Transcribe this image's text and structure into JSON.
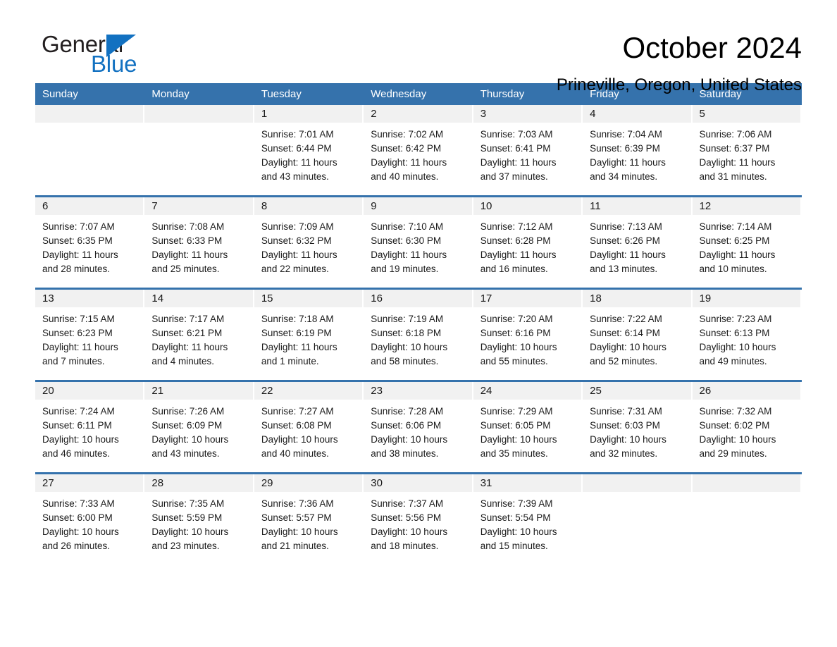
{
  "brand": {
    "name_part1": "General",
    "name_part2": "Blue",
    "accent_color": "#1271c1",
    "triangle_color": "#1271c1"
  },
  "header": {
    "title": "October 2024",
    "subtitle": "Prineville, Oregon, United States"
  },
  "theme": {
    "header_blue": "#3572ac",
    "cell_band_gray": "#f1f1f1",
    "text_color": "#1a1a1a",
    "separator_blue": "#3572ac"
  },
  "calendar": {
    "weekday_headers": [
      "Sunday",
      "Monday",
      "Tuesday",
      "Wednesday",
      "Thursday",
      "Friday",
      "Saturday"
    ],
    "weeks": [
      [
        {
          "day": "",
          "empty": true,
          "lines": []
        },
        {
          "day": "",
          "empty": true,
          "lines": []
        },
        {
          "day": "1",
          "lines": [
            "Sunrise: 7:01 AM",
            "Sunset: 6:44 PM",
            "Daylight: 11 hours",
            "and 43 minutes."
          ]
        },
        {
          "day": "2",
          "lines": [
            "Sunrise: 7:02 AM",
            "Sunset: 6:42 PM",
            "Daylight: 11 hours",
            "and 40 minutes."
          ]
        },
        {
          "day": "3",
          "lines": [
            "Sunrise: 7:03 AM",
            "Sunset: 6:41 PM",
            "Daylight: 11 hours",
            "and 37 minutes."
          ]
        },
        {
          "day": "4",
          "lines": [
            "Sunrise: 7:04 AM",
            "Sunset: 6:39 PM",
            "Daylight: 11 hours",
            "and 34 minutes."
          ]
        },
        {
          "day": "5",
          "lines": [
            "Sunrise: 7:06 AM",
            "Sunset: 6:37 PM",
            "Daylight: 11 hours",
            "and 31 minutes."
          ]
        }
      ],
      [
        {
          "day": "6",
          "lines": [
            "Sunrise: 7:07 AM",
            "Sunset: 6:35 PM",
            "Daylight: 11 hours",
            "and 28 minutes."
          ]
        },
        {
          "day": "7",
          "lines": [
            "Sunrise: 7:08 AM",
            "Sunset: 6:33 PM",
            "Daylight: 11 hours",
            "and 25 minutes."
          ]
        },
        {
          "day": "8",
          "lines": [
            "Sunrise: 7:09 AM",
            "Sunset: 6:32 PM",
            "Daylight: 11 hours",
            "and 22 minutes."
          ]
        },
        {
          "day": "9",
          "lines": [
            "Sunrise: 7:10 AM",
            "Sunset: 6:30 PM",
            "Daylight: 11 hours",
            "and 19 minutes."
          ]
        },
        {
          "day": "10",
          "lines": [
            "Sunrise: 7:12 AM",
            "Sunset: 6:28 PM",
            "Daylight: 11 hours",
            "and 16 minutes."
          ]
        },
        {
          "day": "11",
          "lines": [
            "Sunrise: 7:13 AM",
            "Sunset: 6:26 PM",
            "Daylight: 11 hours",
            "and 13 minutes."
          ]
        },
        {
          "day": "12",
          "lines": [
            "Sunrise: 7:14 AM",
            "Sunset: 6:25 PM",
            "Daylight: 11 hours",
            "and 10 minutes."
          ]
        }
      ],
      [
        {
          "day": "13",
          "lines": [
            "Sunrise: 7:15 AM",
            "Sunset: 6:23 PM",
            "Daylight: 11 hours",
            "and 7 minutes."
          ]
        },
        {
          "day": "14",
          "lines": [
            "Sunrise: 7:17 AM",
            "Sunset: 6:21 PM",
            "Daylight: 11 hours",
            "and 4 minutes."
          ]
        },
        {
          "day": "15",
          "lines": [
            "Sunrise: 7:18 AM",
            "Sunset: 6:19 PM",
            "Daylight: 11 hours",
            "and 1 minute."
          ]
        },
        {
          "day": "16",
          "lines": [
            "Sunrise: 7:19 AM",
            "Sunset: 6:18 PM",
            "Daylight: 10 hours",
            "and 58 minutes."
          ]
        },
        {
          "day": "17",
          "lines": [
            "Sunrise: 7:20 AM",
            "Sunset: 6:16 PM",
            "Daylight: 10 hours",
            "and 55 minutes."
          ]
        },
        {
          "day": "18",
          "lines": [
            "Sunrise: 7:22 AM",
            "Sunset: 6:14 PM",
            "Daylight: 10 hours",
            "and 52 minutes."
          ]
        },
        {
          "day": "19",
          "lines": [
            "Sunrise: 7:23 AM",
            "Sunset: 6:13 PM",
            "Daylight: 10 hours",
            "and 49 minutes."
          ]
        }
      ],
      [
        {
          "day": "20",
          "lines": [
            "Sunrise: 7:24 AM",
            "Sunset: 6:11 PM",
            "Daylight: 10 hours",
            "and 46 minutes."
          ]
        },
        {
          "day": "21",
          "lines": [
            "Sunrise: 7:26 AM",
            "Sunset: 6:09 PM",
            "Daylight: 10 hours",
            "and 43 minutes."
          ]
        },
        {
          "day": "22",
          "lines": [
            "Sunrise: 7:27 AM",
            "Sunset: 6:08 PM",
            "Daylight: 10 hours",
            "and 40 minutes."
          ]
        },
        {
          "day": "23",
          "lines": [
            "Sunrise: 7:28 AM",
            "Sunset: 6:06 PM",
            "Daylight: 10 hours",
            "and 38 minutes."
          ]
        },
        {
          "day": "24",
          "lines": [
            "Sunrise: 7:29 AM",
            "Sunset: 6:05 PM",
            "Daylight: 10 hours",
            "and 35 minutes."
          ]
        },
        {
          "day": "25",
          "lines": [
            "Sunrise: 7:31 AM",
            "Sunset: 6:03 PM",
            "Daylight: 10 hours",
            "and 32 minutes."
          ]
        },
        {
          "day": "26",
          "lines": [
            "Sunrise: 7:32 AM",
            "Sunset: 6:02 PM",
            "Daylight: 10 hours",
            "and 29 minutes."
          ]
        }
      ],
      [
        {
          "day": "27",
          "lines": [
            "Sunrise: 7:33 AM",
            "Sunset: 6:00 PM",
            "Daylight: 10 hours",
            "and 26 minutes."
          ]
        },
        {
          "day": "28",
          "lines": [
            "Sunrise: 7:35 AM",
            "Sunset: 5:59 PM",
            "Daylight: 10 hours",
            "and 23 minutes."
          ]
        },
        {
          "day": "29",
          "lines": [
            "Sunrise: 7:36 AM",
            "Sunset: 5:57 PM",
            "Daylight: 10 hours",
            "and 21 minutes."
          ]
        },
        {
          "day": "30",
          "lines": [
            "Sunrise: 7:37 AM",
            "Sunset: 5:56 PM",
            "Daylight: 10 hours",
            "and 18 minutes."
          ]
        },
        {
          "day": "31",
          "lines": [
            "Sunrise: 7:39 AM",
            "Sunset: 5:54 PM",
            "Daylight: 10 hours",
            "and 15 minutes."
          ]
        },
        {
          "day": "",
          "empty": true,
          "lines": []
        },
        {
          "day": "",
          "empty": true,
          "lines": []
        }
      ]
    ]
  }
}
